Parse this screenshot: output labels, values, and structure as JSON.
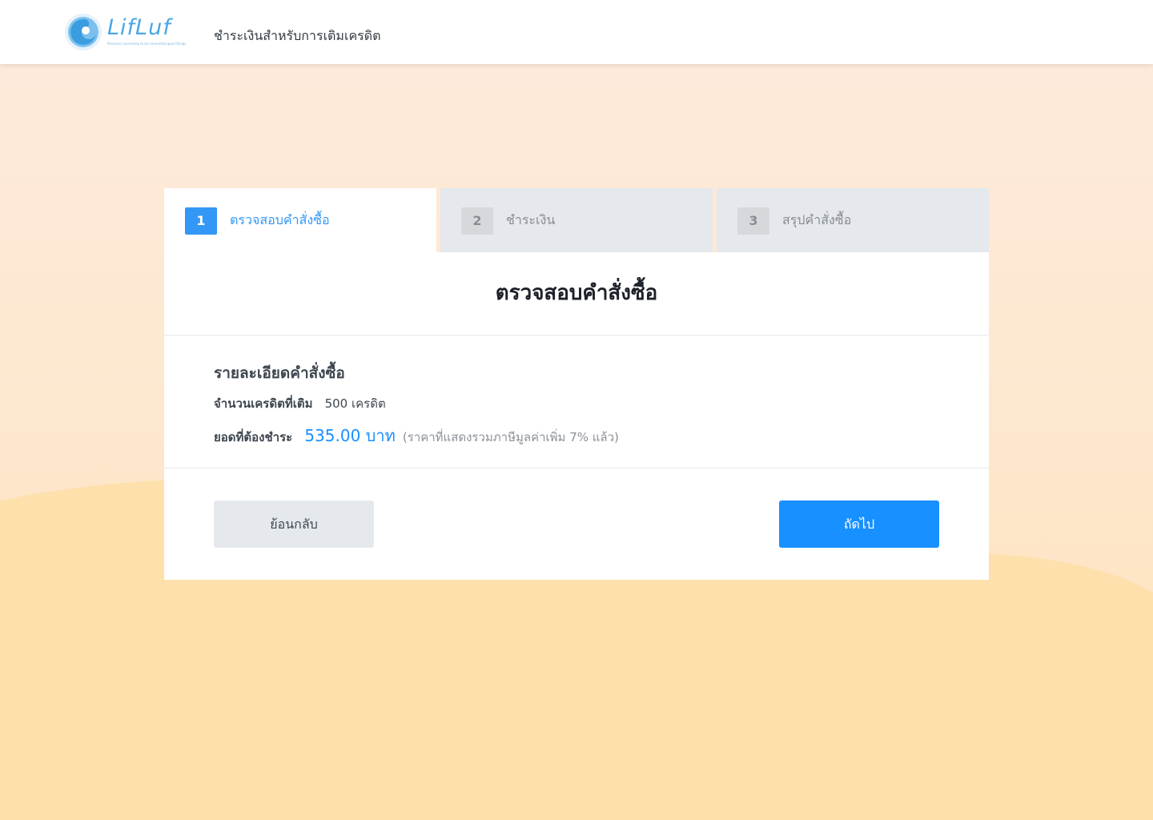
{
  "header": {
    "logo_text": "LifLuf",
    "logo_tagline": "Personal counseling to be connected good things",
    "title": "ชำระเงินสำหรับการเติมเครดิต"
  },
  "steps": [
    {
      "number": "1",
      "label": "ตรวจสอบคำสั่งซื้อ",
      "active": true
    },
    {
      "number": "2",
      "label": "ชำระเงิน",
      "active": false
    },
    {
      "number": "3",
      "label": "สรุปคำสั่งซื้อ",
      "active": false
    }
  ],
  "panel": {
    "title": "ตรวจสอบคำสั่งซื้อ",
    "section_title": "รายละเอียดคำสั่งซื้อ",
    "credit_label": "จำนวนเครดิตที่เติม",
    "credit_value": "500 เครดิต",
    "amount_label": "ยอดที่ต้องชำระ",
    "amount_value": "535.00 บาท",
    "amount_note": "(ราคาที่แสดงรวมภาษีมูลค่าเพิ่ม 7% แล้ว)"
  },
  "buttons": {
    "back_label": "ย้อนกลับ",
    "next_label": "ถัดไป"
  },
  "colors": {
    "accent": "#1890ff",
    "step_active": "#3398f5",
    "step_inactive_bg": "#e5e9ed",
    "background_top": "#fdebdc",
    "background_wave": "#fee2ba"
  }
}
